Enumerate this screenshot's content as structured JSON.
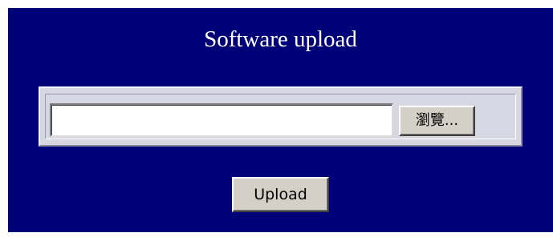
{
  "page": {
    "title": "Software upload"
  },
  "file_picker": {
    "value": "",
    "browse_label": "瀏覽..."
  },
  "actions": {
    "upload_label": "Upload"
  },
  "colors": {
    "panel_background": "#000078",
    "title_text": "#ffffff",
    "frame_background": "#d7d7e3",
    "button_face": "#d4d0c8"
  }
}
